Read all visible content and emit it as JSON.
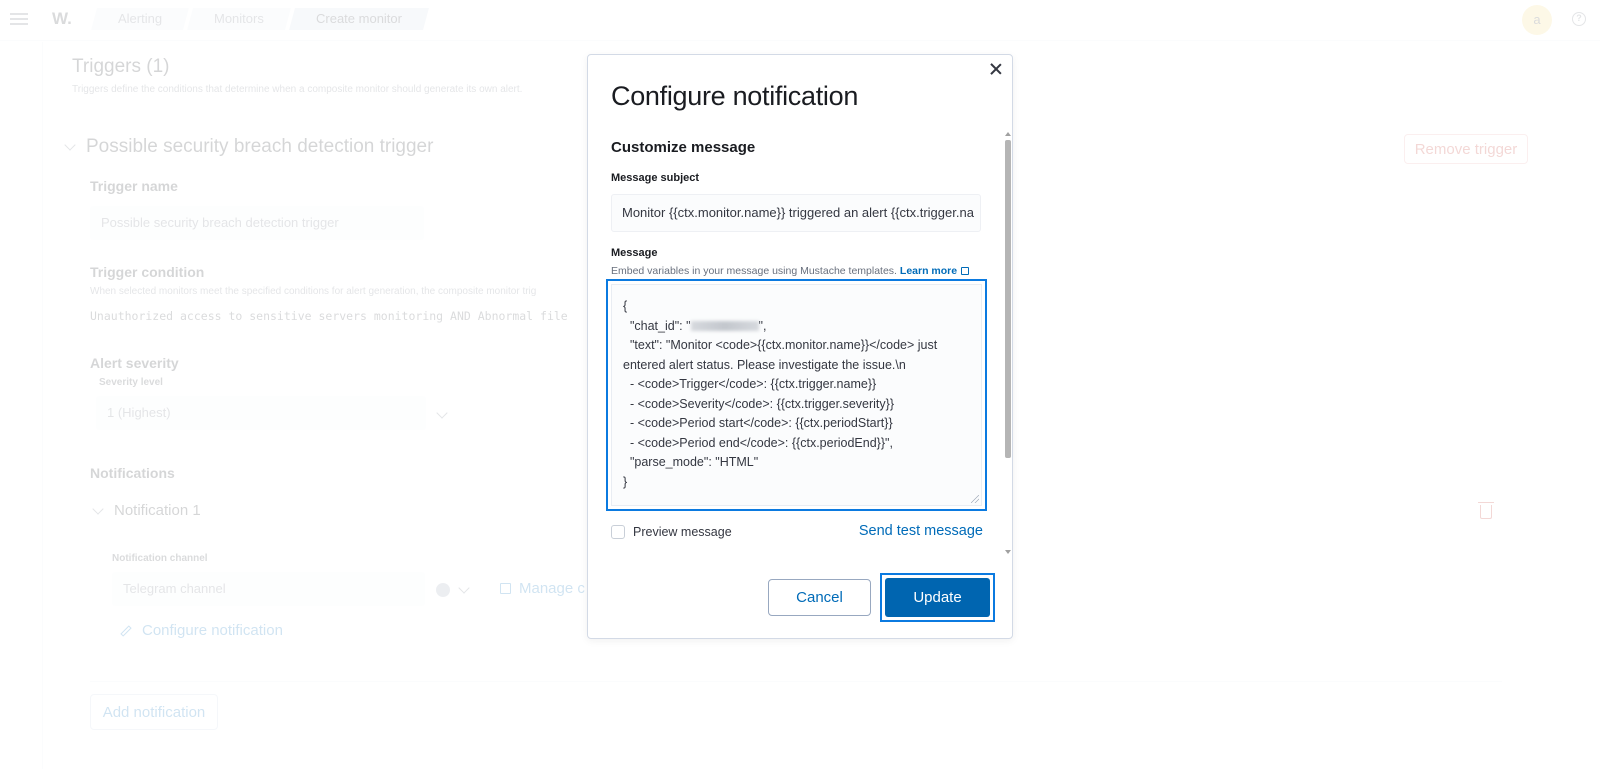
{
  "header": {
    "logo": "W.",
    "breadcrumbs": [
      "Alerting",
      "Monitors",
      "Create monitor"
    ],
    "avatar_initial": "a",
    "help_glyph": "?"
  },
  "page": {
    "triggers_title": "Triggers (1)",
    "triggers_description": "Triggers define the conditions that determine when a composite monitor should generate its own alert.",
    "trigger_heading": "Possible security breach detection trigger",
    "remove_trigger_label": "Remove trigger",
    "trigger_name_label": "Trigger name",
    "trigger_name_value": "Possible security breach detection trigger",
    "trigger_condition_label": "Trigger condition",
    "trigger_condition_help": "When selected monitors meet the specified conditions for alert generation, the composite monitor trig",
    "trigger_condition_expression": "Unauthorized access to sensitive servers monitoring AND Abnormal file",
    "alert_severity_label": "Alert severity",
    "severity_level_label": "Severity level",
    "severity_value": "1 (Highest)",
    "notifications_label": "Notifications",
    "notification_heading": "Notification 1",
    "notification_channel_label": "Notification channel",
    "notification_channel_value": "Telegram channel",
    "manage_channels_label": "Manage c",
    "configure_notification_label": "Configure notification",
    "add_notification_label": "Add notification"
  },
  "modal": {
    "title": "Configure notification",
    "section_title": "Customize message",
    "subject_label": "Message subject",
    "subject_value": "Monitor {{ctx.monitor.name}} triggered an alert {{ctx.trigger.na",
    "message_label": "Message",
    "message_help": "Embed variables in your message using Mustache templates.",
    "learn_more_label": "Learn more",
    "message_lines": {
      "l1": "{",
      "l2_prefix": "  \"chat_id\": \"",
      "l2_suffix": "\",",
      "l3": "  \"text\": \"Monitor <code>{{ctx.monitor.name}}</code> just entered alert status. Please investigate the issue.\\n",
      "l4": "  - <code>Trigger</code>: {{ctx.trigger.name}}",
      "l5": "  - <code>Severity</code>: {{ctx.trigger.severity}}",
      "l6": "  - <code>Period start</code>: {{ctx.periodStart}}",
      "l7": "  - <code>Period end</code>: {{ctx.periodEnd}}\",",
      "l8": "  \"parse_mode\": \"HTML\"",
      "l9": "}"
    },
    "chat_id_redacted": true,
    "preview_label": "Preview message",
    "preview_checked": false,
    "send_test_label": "Send test message",
    "cancel_label": "Cancel",
    "update_label": "Update"
  },
  "colors": {
    "accent": "#0065b0",
    "focus_ring": "#0b7ae0",
    "link": "#006bb8",
    "danger": "#bd271e"
  }
}
